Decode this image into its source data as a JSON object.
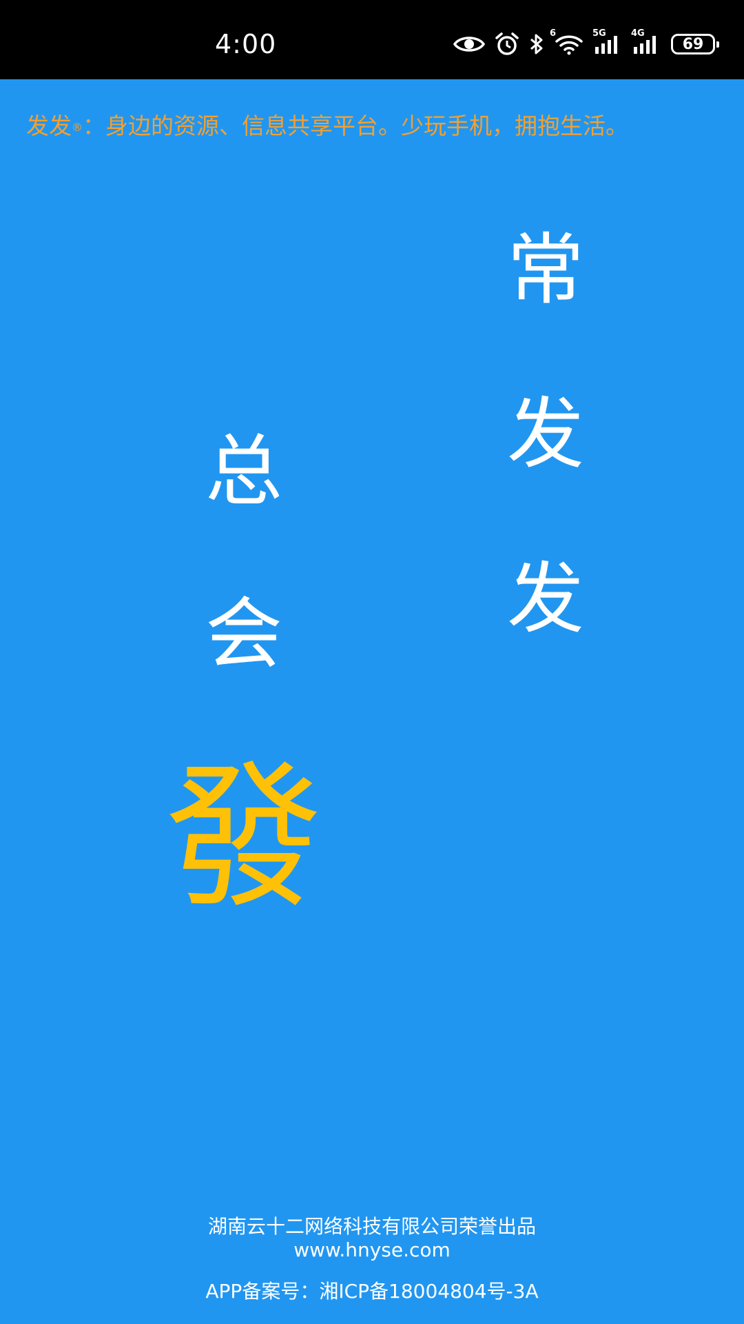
{
  "status_bar": {
    "time": "4:00",
    "wifi_badge": "6",
    "net1_label": "5G",
    "net2_label": "4G",
    "battery": "69",
    "icons": [
      "eye-icon",
      "alarm-icon",
      "bluetooth-icon",
      "wifi-icon",
      "signal-5g-icon",
      "signal-4g-icon",
      "battery-icon"
    ]
  },
  "splash": {
    "background_color": "#2196f0",
    "slogan_prefix": "发发",
    "slogan_mark": "®",
    "slogan_text": "：身边的资源、信息共享平台。少玩手机，拥抱生活。",
    "slogan_color": "#f3a030",
    "right_column": [
      "常",
      "发",
      "发"
    ],
    "left_column": [
      "总",
      "会"
    ],
    "feature_char": "發",
    "feature_color": "#ffc107"
  },
  "footer": {
    "company": "湖南云十二网络科技有限公司荣誉出品",
    "website": "www.hnyse.com",
    "icp": "APP备案号：湘ICP备18004804号-3A"
  }
}
